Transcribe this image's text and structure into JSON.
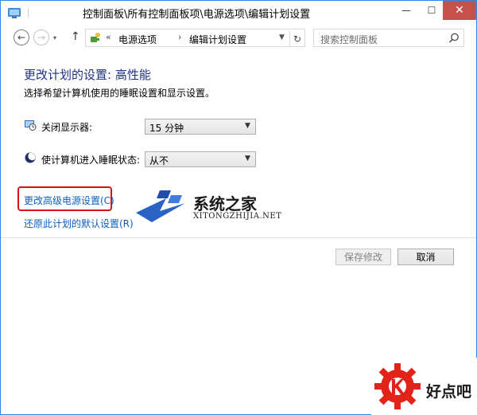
{
  "window": {
    "title": "控制面板\\所有控制面板项\\电源选项\\编辑计划设置",
    "minimize_glyph": "—",
    "maximize_glyph": "☐",
    "close_glyph": "✕"
  },
  "navigation": {
    "back_glyph": "←",
    "forward_glyph": "→",
    "up_glyph": "↑",
    "address_overflow": "«",
    "breadcrumbs": [
      "电源选项",
      "编辑计划设置"
    ],
    "breadcrumb_separator": "›",
    "refresh_glyph": "↻",
    "search_placeholder": "搜索控制面板"
  },
  "main": {
    "title": "更改计划的设置: 高性能",
    "subtitle": "选择希望计算机使用的睡眠设置和显示设置。",
    "settings": [
      {
        "label": "关闭显示器:",
        "value": "15 分钟",
        "icon": "monitor-clock-icon"
      },
      {
        "label": "使计算机进入睡眠状态:",
        "value": "从不",
        "icon": "moon-icon"
      }
    ],
    "links": {
      "advanced": "更改高级电源设置(C)",
      "restore": "还原此计划的默认设置(R)"
    },
    "buttons": {
      "save": "保存修改",
      "cancel": "取消"
    }
  },
  "watermark": {
    "title": "系统之家",
    "url": "XITONGZHIJIA.NET"
  },
  "corner_logo": {
    "text": "好点吧"
  },
  "colors": {
    "title_blue": "#1e3287",
    "link_blue": "#0b5fbf",
    "highlight_red": "#d8121a",
    "close_red": "#c7504d",
    "logo_red": "#e2231a"
  }
}
